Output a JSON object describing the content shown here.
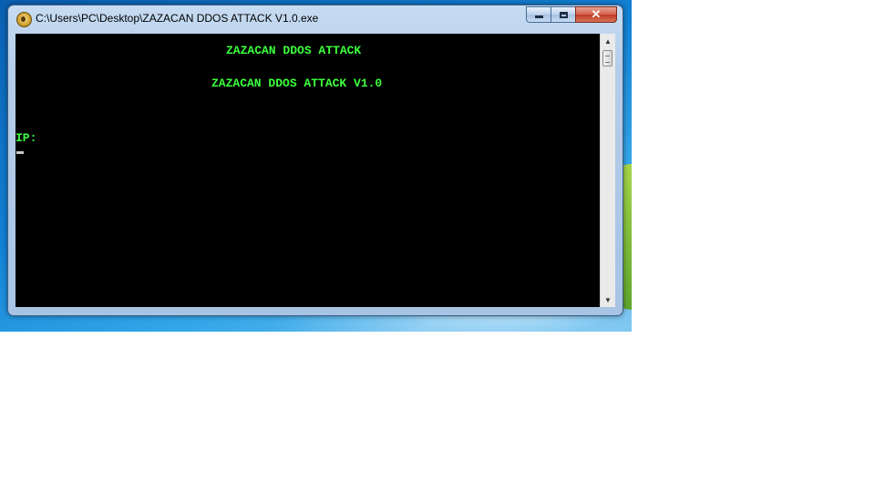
{
  "window": {
    "title": "C:\\Users\\PC\\Desktop\\ZAZACAN DDOS ATTACK V1.0.exe",
    "close_glyph": "✕"
  },
  "console": {
    "lines": [
      "ZAZACAN DDOS ATTACK",
      "ZAZACAN DDOS ATTACK V1.0",
      "IP:"
    ],
    "text_color": "#3cff3c",
    "background": "#000000"
  },
  "scrollbar": {
    "up_glyph": "▲",
    "down_glyph": "▼"
  },
  "icons": {
    "app": "app-icon",
    "minimize": "minimize-icon",
    "maximize": "maximize-icon",
    "close": "close-icon"
  }
}
